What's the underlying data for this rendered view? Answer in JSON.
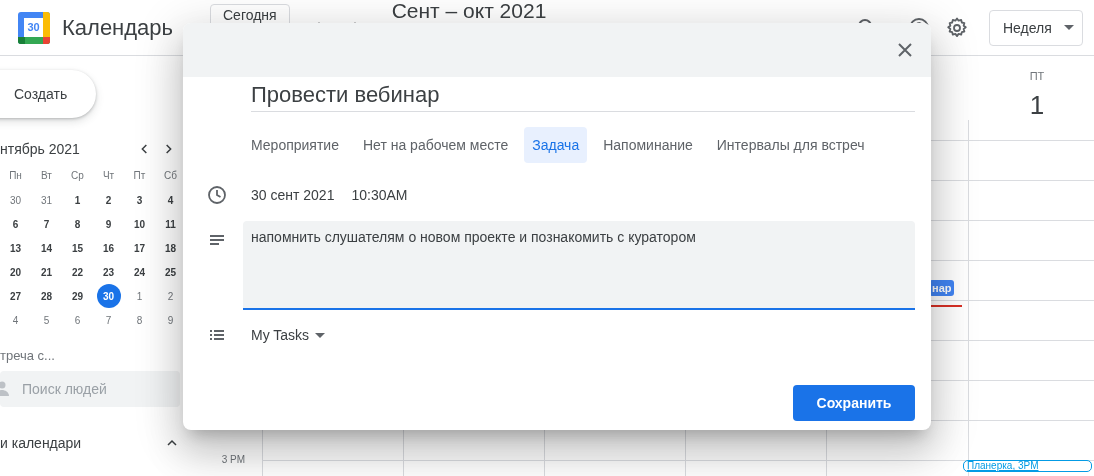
{
  "header": {
    "logo_text": "30",
    "app_name": "Календарь",
    "today_button": "Сегодня",
    "date_range": "Сент – окт 2021",
    "view_select": "Неделя"
  },
  "sidebar": {
    "create_button": "Создать",
    "mini_calendar": {
      "title": "нтябрь 2021",
      "weekdays": [
        "Пн",
        "Вт",
        "Ср",
        "Чт",
        "Пт",
        "Сб"
      ],
      "weeks": [
        [
          {
            "day": "30",
            "muted": true,
            "selected": false
          },
          {
            "day": "31",
            "muted": true,
            "selected": false
          },
          {
            "day": "1",
            "muted": false,
            "selected": false
          },
          {
            "day": "2",
            "muted": false,
            "selected": false
          },
          {
            "day": "3",
            "muted": false,
            "selected": false
          },
          {
            "day": "4",
            "muted": false,
            "selected": false
          }
        ],
        [
          {
            "day": "6",
            "muted": false,
            "selected": false
          },
          {
            "day": "7",
            "muted": false,
            "selected": false
          },
          {
            "day": "8",
            "muted": false,
            "selected": false
          },
          {
            "day": "9",
            "muted": false,
            "selected": false
          },
          {
            "day": "10",
            "muted": false,
            "selected": false
          },
          {
            "day": "11",
            "muted": false,
            "selected": false
          }
        ],
        [
          {
            "day": "13",
            "muted": false,
            "selected": false
          },
          {
            "day": "14",
            "muted": false,
            "selected": false
          },
          {
            "day": "15",
            "muted": false,
            "selected": false
          },
          {
            "day": "16",
            "muted": false,
            "selected": false
          },
          {
            "day": "17",
            "muted": false,
            "selected": false
          },
          {
            "day": "18",
            "muted": false,
            "selected": false
          }
        ],
        [
          {
            "day": "20",
            "muted": false,
            "selected": false
          },
          {
            "day": "21",
            "muted": false,
            "selected": false
          },
          {
            "day": "22",
            "muted": false,
            "selected": false
          },
          {
            "day": "23",
            "muted": false,
            "selected": false
          },
          {
            "day": "24",
            "muted": false,
            "selected": false
          },
          {
            "day": "25",
            "muted": false,
            "selected": false
          }
        ],
        [
          {
            "day": "27",
            "muted": false,
            "selected": false
          },
          {
            "day": "28",
            "muted": false,
            "selected": false
          },
          {
            "day": "29",
            "muted": false,
            "selected": false
          },
          {
            "day": "30",
            "muted": false,
            "selected": true
          },
          {
            "day": "1",
            "muted": true,
            "selected": false
          },
          {
            "day": "2",
            "muted": true,
            "selected": false
          }
        ],
        [
          {
            "day": "4",
            "muted": true,
            "selected": false
          },
          {
            "day": "5",
            "muted": true,
            "selected": false
          },
          {
            "day": "6",
            "muted": true,
            "selected": false
          },
          {
            "day": "7",
            "muted": true,
            "selected": false
          },
          {
            "day": "8",
            "muted": true,
            "selected": false
          },
          {
            "day": "9",
            "muted": true,
            "selected": false
          }
        ]
      ]
    },
    "meet_with": "треча с...",
    "people_search": {
      "placeholder": "Поиск людей"
    },
    "my_calendars": {
      "label": "и календари",
      "expanded": true
    }
  },
  "week_view": {
    "visible_day": {
      "weekday": "ПТ",
      "date": "1"
    },
    "time_label": "3 PM",
    "events": [
      {
        "title": "нар",
        "kind": "solid"
      },
      {
        "title": "Планерка, 3PM",
        "kind": "outlined"
      }
    ]
  },
  "dialog": {
    "title_value": "Провести вебинар",
    "tabs": [
      {
        "label": "Мероприятие",
        "selected": false
      },
      {
        "label": "Нет на рабочем месте",
        "selected": false
      },
      {
        "label": "Задача",
        "selected": true
      },
      {
        "label": "Напоминание",
        "selected": false
      },
      {
        "label": "Интервалы для встреч",
        "selected": false
      }
    ],
    "date": "30 сент 2021",
    "time": "10:30AM",
    "description_value": "напомнить слушателям о новом проекте и познакомить с куратором ",
    "task_list": "My Tasks",
    "save_button": "Сохранить"
  }
}
